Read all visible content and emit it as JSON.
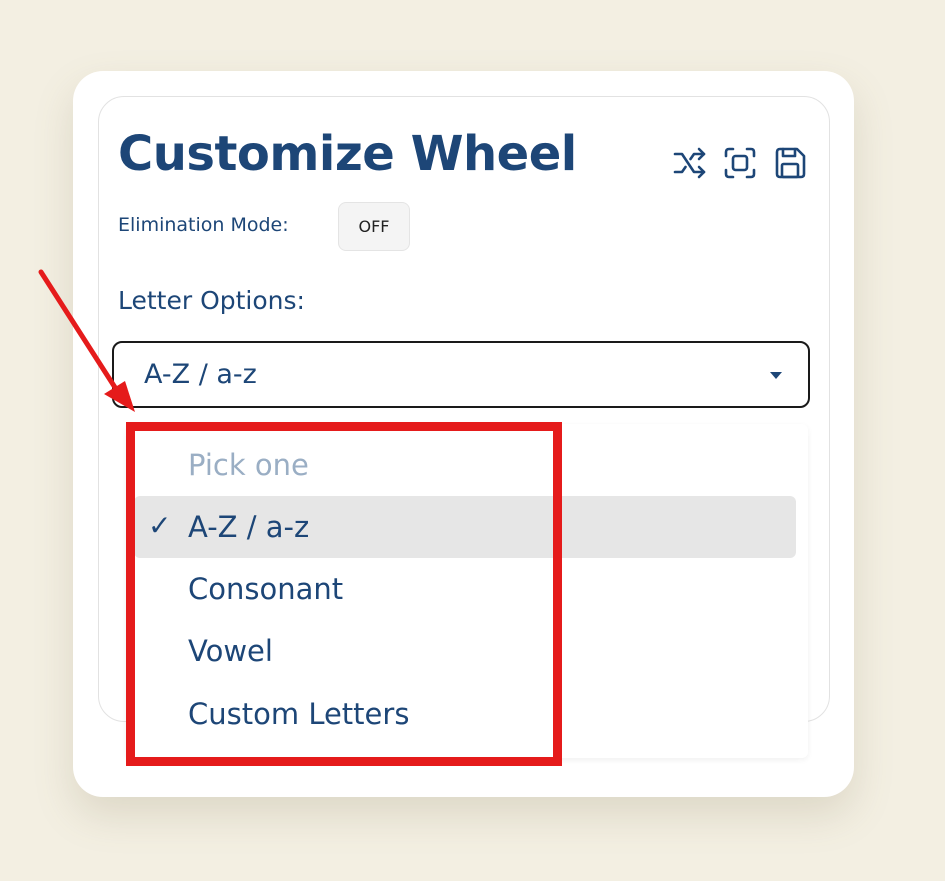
{
  "panel": {
    "title": "Customize Wheel",
    "toolbar": {
      "shuffle_icon": "shuffle-icon",
      "fullscreen_icon": "fullscreen-icon",
      "save_icon": "save-icon"
    }
  },
  "elimination": {
    "label": "Elimination Mode:",
    "toggle_value": "OFF"
  },
  "letter_options": {
    "label": "Letter Options:",
    "selected": "A-Z / a-z",
    "check_glyph": "✓",
    "options": [
      {
        "label": "Pick one",
        "placeholder": true
      },
      {
        "label": "A-Z / a-z",
        "selected": true
      },
      {
        "label": "Consonant"
      },
      {
        "label": "Vowel"
      },
      {
        "label": "Custom Letters"
      }
    ]
  },
  "annotation": {
    "color": "#e51b1b"
  },
  "colors": {
    "text_primary": "#1d4677",
    "background": "#f3efe2",
    "selected_option_bg": "#e6e6e6"
  }
}
